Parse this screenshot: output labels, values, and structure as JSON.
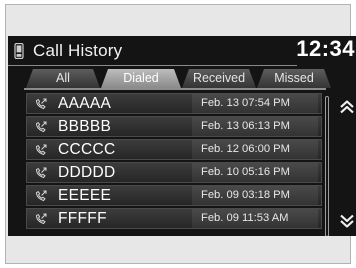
{
  "header": {
    "title": "Call History",
    "time": "12:34",
    "icon": "phone-icon"
  },
  "tabs": [
    {
      "label": "All",
      "active": false
    },
    {
      "label": "Dialed",
      "active": true
    },
    {
      "label": "Received",
      "active": false
    },
    {
      "label": "Missed",
      "active": false
    }
  ],
  "calls": [
    {
      "name": "AAAAA",
      "datetime": "Feb. 13 07:54 PM",
      "icon": "dialed-call-icon"
    },
    {
      "name": "BBBBB",
      "datetime": "Feb. 13 06:13 PM",
      "icon": "dialed-call-icon"
    },
    {
      "name": "CCCCC",
      "datetime": "Feb. 12 06:00 PM",
      "icon": "dialed-call-icon"
    },
    {
      "name": "DDDDD",
      "datetime": "Feb. 10 05:16 PM",
      "icon": "dialed-call-icon"
    },
    {
      "name": "EEEEE",
      "datetime": "Feb. 09 03:18 PM",
      "icon": "dialed-call-icon"
    },
    {
      "name": "FFFFF",
      "datetime": "Feb. 09 11:53 AM",
      "icon": "dialed-call-icon"
    }
  ],
  "scroll": {
    "up_icon": "double-chevron-up-icon",
    "down_icon": "double-chevron-down-icon"
  },
  "colors": {
    "screen_bg": "#141414",
    "frame_bg": "#e7e7e7",
    "active_tab": "#a3a3a3",
    "text": "#ffffff"
  }
}
